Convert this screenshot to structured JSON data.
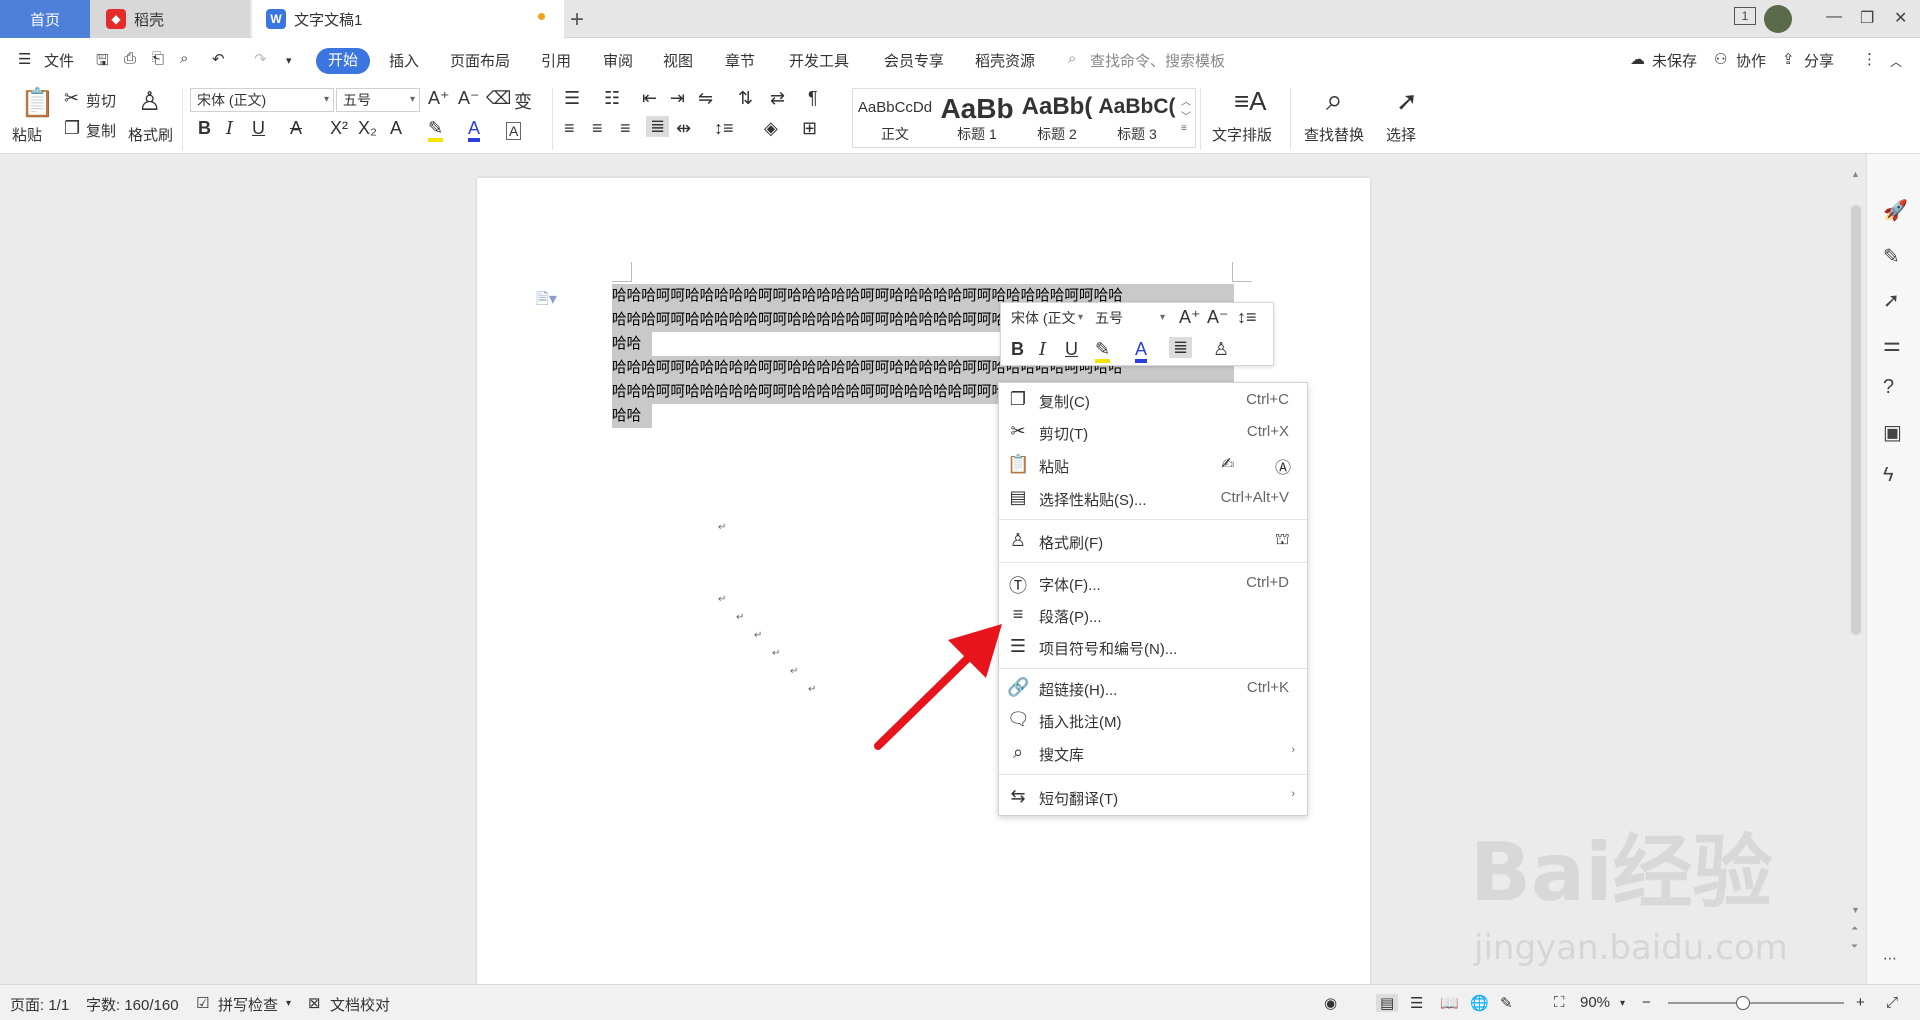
{
  "tabs": [
    {
      "label": "首页"
    },
    {
      "label": "稻壳"
    },
    {
      "label": "文字文稿1"
    }
  ],
  "window": {
    "page_badge": "1"
  },
  "menu": {
    "file": "文件",
    "items": [
      "开始",
      "插入",
      "页面布局",
      "引用",
      "审阅",
      "视图",
      "章节",
      "开发工具",
      "会员专享",
      "稻壳资源"
    ],
    "search_placeholder": "查找命令、搜索模板",
    "unsaved": "未保存",
    "collab": "协作",
    "share": "分享"
  },
  "ribbon": {
    "paste": "粘贴",
    "cut": "剪切",
    "copy": "复制",
    "format_painter": "格式刷",
    "font_name": "宋体 (正文)",
    "font_size": "五号",
    "styles": [
      {
        "sample": "AaBbCcDd",
        "name": "正文"
      },
      {
        "sample": "AaBb",
        "name": "标题 1"
      },
      {
        "sample": "AaBb(",
        "name": "标题 2"
      },
      {
        "sample": "AaBbC(",
        "name": "标题 3"
      }
    ],
    "text_layout": "文字排版",
    "find_replace": "查找替换",
    "select": "选择"
  },
  "document": {
    "lines": [
      "哈哈哈呵呵哈哈哈哈哈呵呵哈哈哈哈哈呵呵哈哈哈哈哈呵呵哈哈哈哈哈呵呵哈哈",
      "哈哈哈呵呵哈哈哈哈哈呵呵哈哈哈哈哈呵呵哈哈哈哈哈呵呵哈哈哈哈哈呵呵哈哈",
      "哈哈",
      "哈哈哈呵呵哈哈哈哈哈呵呵哈哈哈哈哈呵呵哈哈哈哈哈呵呵哈哈哈哈哈呵呵哈哈",
      "哈哈哈呵呵哈哈哈哈哈呵呵哈哈哈哈哈呵呵哈哈哈哈哈呵呵哈哈哈哈哈呵呵哈哈",
      "哈哈"
    ],
    "para_mark": "↵"
  },
  "mini_toolbar": {
    "font_name": "宋体 (正文",
    "font_size": "五号"
  },
  "context_menu": [
    {
      "label": "复制(C)",
      "shortcut": "Ctrl+C"
    },
    {
      "label": "剪切(T)",
      "shortcut": "Ctrl+X"
    },
    {
      "label": "粘贴",
      "shortcut": ""
    },
    {
      "label": "选择性粘贴(S)...",
      "shortcut": "Ctrl+Alt+V"
    },
    {
      "label": "格式刷(F)",
      "shortcut": ""
    },
    {
      "label": "字体(F)...",
      "shortcut": "Ctrl+D"
    },
    {
      "label": "段落(P)...",
      "shortcut": ""
    },
    {
      "label": "项目符号和编号(N)...",
      "shortcut": ""
    },
    {
      "label": "超链接(H)...",
      "shortcut": "Ctrl+K"
    },
    {
      "label": "插入批注(M)",
      "shortcut": ""
    },
    {
      "label": "搜文库",
      "shortcut": ""
    },
    {
      "label": "短句翻译(T)",
      "shortcut": ""
    }
  ],
  "status": {
    "page": "页面: 1/1",
    "words": "字数: 160/160",
    "spell": "拼写检查",
    "proof": "文档校对",
    "zoom": "90%"
  },
  "watermark": {
    "brand": "Bai经验",
    "url": "jingyan.baidu.com"
  },
  "colors": {
    "accent": "#3b75e0",
    "tab_home": "#4e7fd9",
    "arrow": "#e8141b",
    "highlight": "#c9c9c9",
    "font_color": "#2b3ee0",
    "highlight_yellow": "#f5e600"
  }
}
